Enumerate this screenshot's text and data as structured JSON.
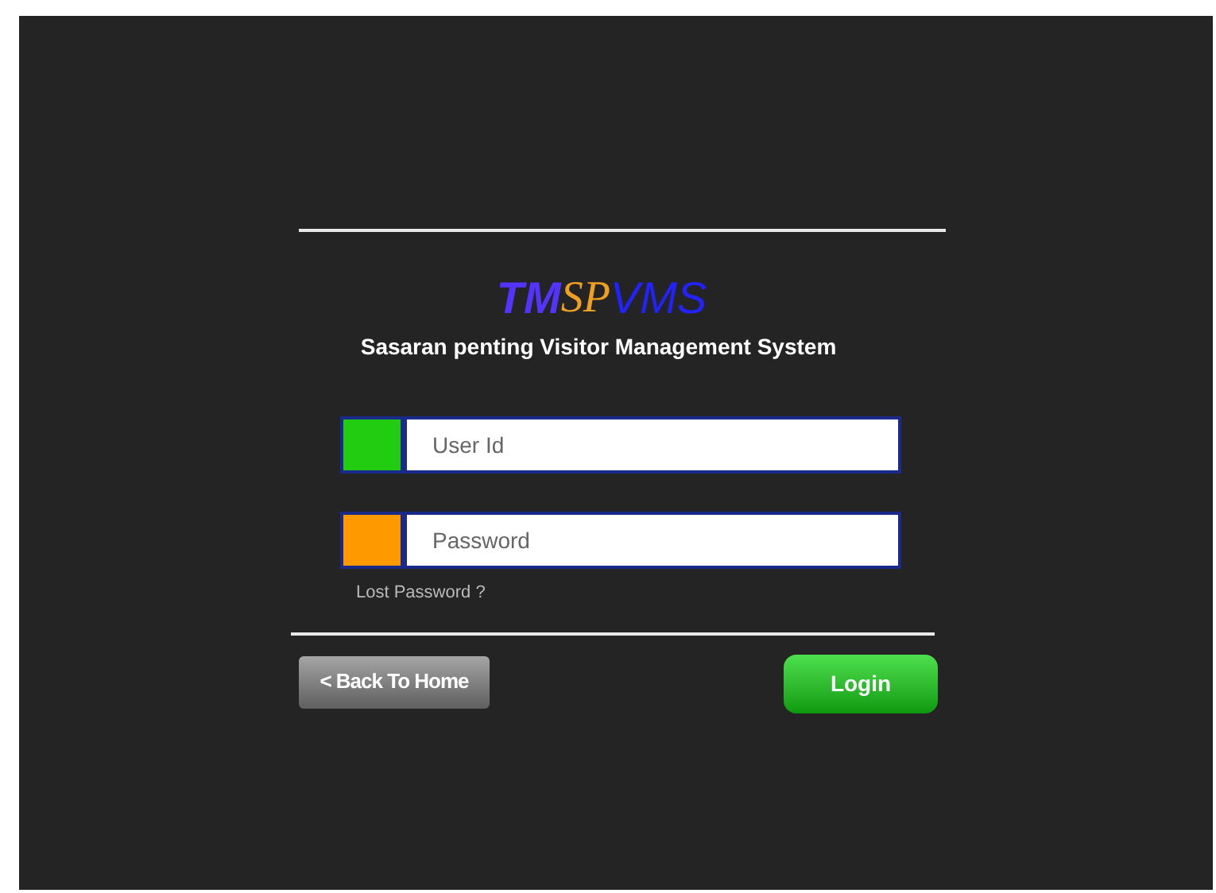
{
  "logo": [
    {
      "text": "TM",
      "color": "#5533ff",
      "kind": "bold"
    },
    {
      "text": "SP",
      "color": "#f0a020",
      "kind": "serif"
    },
    {
      "text": "VMS",
      "color": "#2222ff",
      "kind": "plain"
    }
  ],
  "subtitle": "Sasaran penting Visitor Management System",
  "fields": [
    {
      "placeholder": "User Id",
      "color": "#22cc11"
    },
    {
      "placeholder": "Password",
      "color": "#ff9900"
    }
  ],
  "lost_password_link": "Lost Password ?",
  "buttons": [
    {
      "label": "< Back To Home",
      "kind": "secondary"
    },
    {
      "label": "Login",
      "kind": "primary"
    }
  ]
}
